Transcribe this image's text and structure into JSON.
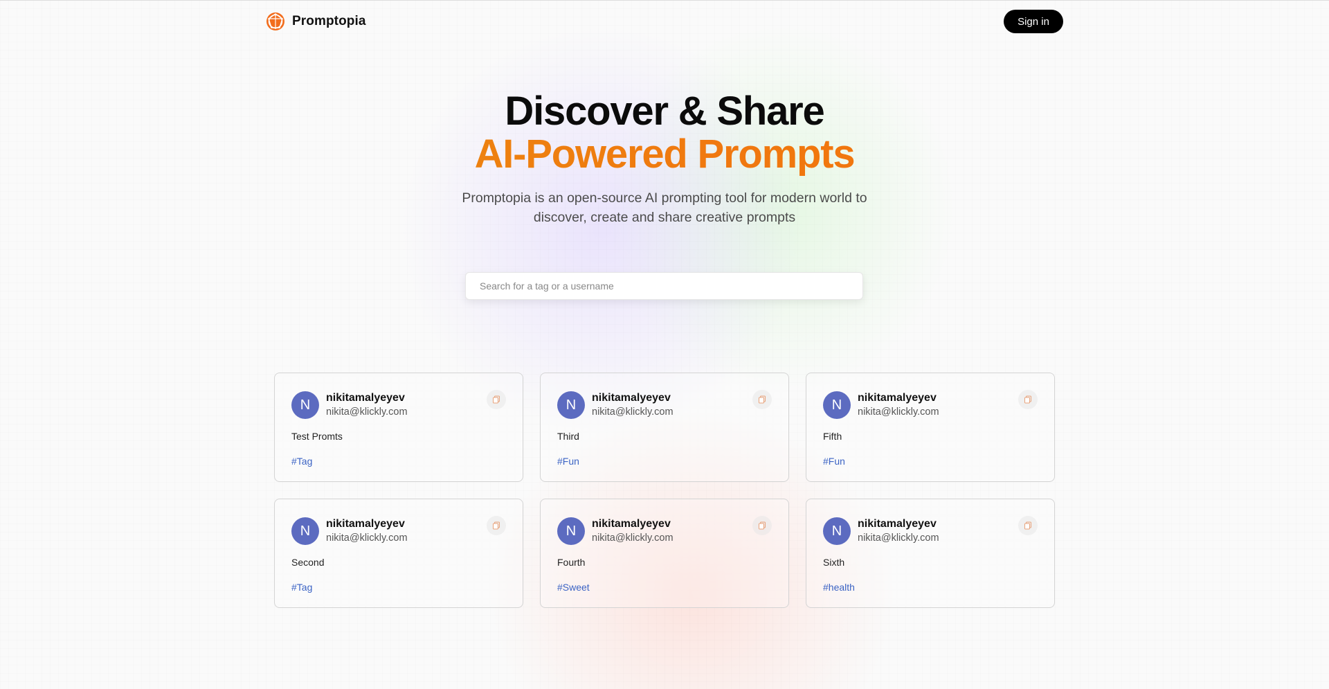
{
  "nav": {
    "brand": "Promptopia",
    "sign_in_label": "Sign in"
  },
  "hero": {
    "title_line1": "Discover & Share",
    "title_line2": "AI-Powered Prompts",
    "description": "Promptopia is an open-source AI prompting tool for modern world to discover, create and share creative prompts"
  },
  "search": {
    "placeholder": "Search for a tag or a username",
    "value": ""
  },
  "colors": {
    "accent_orange": "#f5720a",
    "avatar": "#5c6bc0",
    "tag_blue": "#3b63c4"
  },
  "cards": [
    {
      "avatar_letter": "N",
      "username": "nikitamalyeyev",
      "email": "nikita@klickly.com",
      "prompt": "Test Promts",
      "tag": "#Tag"
    },
    {
      "avatar_letter": "N",
      "username": "nikitamalyeyev",
      "email": "nikita@klickly.com",
      "prompt": "Third",
      "tag": "#Fun"
    },
    {
      "avatar_letter": "N",
      "username": "nikitamalyeyev",
      "email": "nikita@klickly.com",
      "prompt": "Fifth",
      "tag": "#Fun"
    },
    {
      "avatar_letter": "N",
      "username": "nikitamalyeyev",
      "email": "nikita@klickly.com",
      "prompt": "Second",
      "tag": "#Tag"
    },
    {
      "avatar_letter": "N",
      "username": "nikitamalyeyev",
      "email": "nikita@klickly.com",
      "prompt": "Fourth",
      "tag": "#Sweet"
    },
    {
      "avatar_letter": "N",
      "username": "nikitamalyeyev",
      "email": "nikita@klickly.com",
      "prompt": "Sixth",
      "tag": "#health"
    }
  ]
}
